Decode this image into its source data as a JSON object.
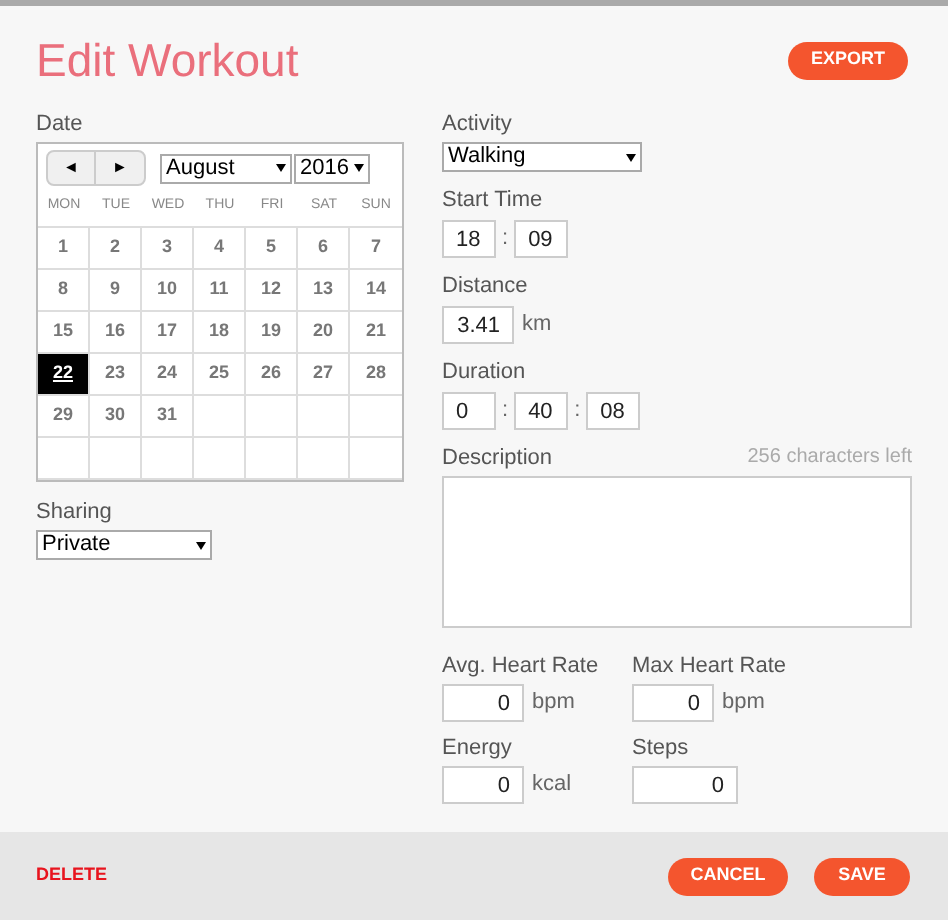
{
  "title": "Edit Workout",
  "export_button": "EXPORT",
  "date": {
    "label": "Date",
    "prev": "◄",
    "next": "►",
    "month": "August",
    "year": "2016",
    "weekdays": [
      "MON",
      "TUE",
      "WED",
      "THU",
      "FRI",
      "SAT",
      "SUN"
    ],
    "days": [
      {
        "label": "1",
        "selected": false
      },
      {
        "label": "2",
        "selected": false
      },
      {
        "label": "3",
        "selected": false
      },
      {
        "label": "4",
        "selected": false
      },
      {
        "label": "5",
        "selected": false
      },
      {
        "label": "6",
        "selected": false
      },
      {
        "label": "7",
        "selected": false
      },
      {
        "label": "8",
        "selected": false
      },
      {
        "label": "9",
        "selected": false
      },
      {
        "label": "10",
        "selected": false
      },
      {
        "label": "11",
        "selected": false
      },
      {
        "label": "12",
        "selected": false
      },
      {
        "label": "13",
        "selected": false
      },
      {
        "label": "14",
        "selected": false
      },
      {
        "label": "15",
        "selected": false
      },
      {
        "label": "16",
        "selected": false
      },
      {
        "label": "17",
        "selected": false
      },
      {
        "label": "18",
        "selected": false
      },
      {
        "label": "19",
        "selected": false
      },
      {
        "label": "20",
        "selected": false
      },
      {
        "label": "21",
        "selected": false
      },
      {
        "label": "22",
        "selected": true
      },
      {
        "label": "23",
        "selected": false
      },
      {
        "label": "24",
        "selected": false
      },
      {
        "label": "25",
        "selected": false
      },
      {
        "label": "26",
        "selected": false
      },
      {
        "label": "27",
        "selected": false
      },
      {
        "label": "28",
        "selected": false
      },
      {
        "label": "29",
        "selected": false
      },
      {
        "label": "30",
        "selected": false
      },
      {
        "label": "31",
        "selected": false
      }
    ]
  },
  "sharing": {
    "label": "Sharing",
    "value": "Private"
  },
  "activity": {
    "label": "Activity",
    "value": "Walking"
  },
  "start_time": {
    "label": "Start Time",
    "hours": "18",
    "minutes": "09",
    "separator": ":"
  },
  "distance": {
    "label": "Distance",
    "value": "3.41",
    "unit": "km"
  },
  "duration": {
    "label": "Duration",
    "hours": "0",
    "minutes": "40",
    "seconds": "08",
    "separator": ":"
  },
  "description": {
    "label": "Description",
    "counter": "256 characters left"
  },
  "avg_heart_rate": {
    "label": "Avg. Heart Rate",
    "value": "0",
    "unit": "bpm"
  },
  "max_heart_rate": {
    "label": "Max Heart Rate",
    "value": "0",
    "unit": "bpm"
  },
  "energy": {
    "label": "Energy",
    "value": "0",
    "unit": "kcal"
  },
  "steps": {
    "label": "Steps",
    "value": "0"
  },
  "footer": {
    "delete": "DELETE",
    "cancel": "CANCEL",
    "save": "SAVE"
  }
}
